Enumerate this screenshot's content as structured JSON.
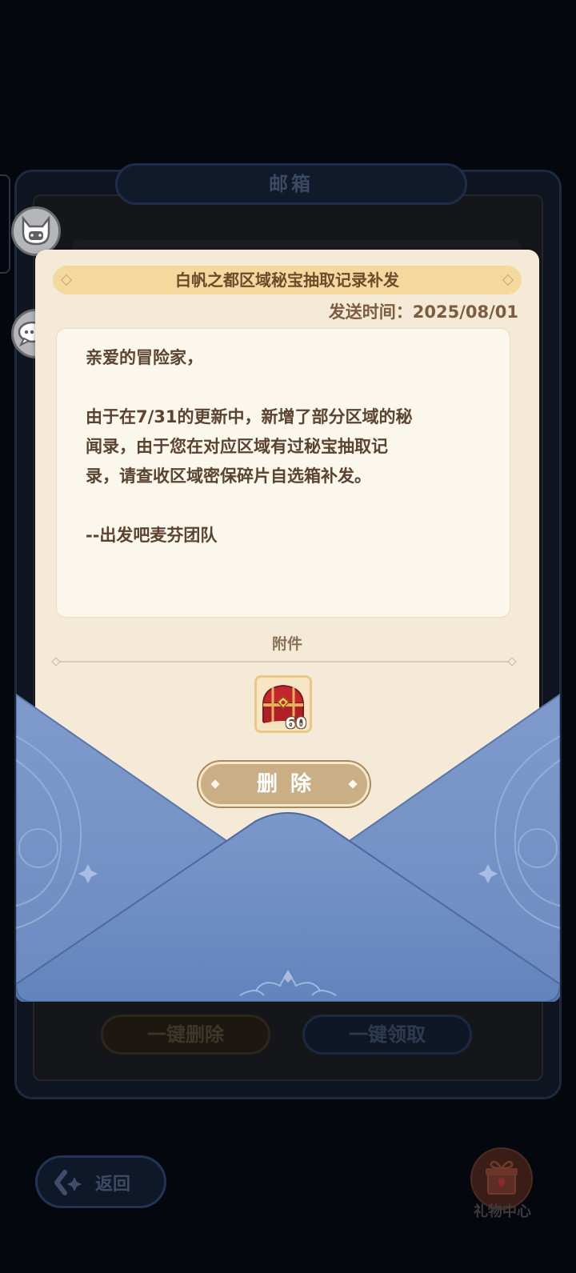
{
  "background": {
    "mailbox_title": "邮箱",
    "batch_delete_label": "一键删除",
    "batch_claim_label": "一键领取"
  },
  "side_icons": [
    {
      "icon": "cat-avatar-icon"
    },
    {
      "icon": "chat-bubbles-icon"
    }
  ],
  "mail": {
    "title": "白帆之都区域秘宝抽取记录补发",
    "send_time": "发送时间：2025/08/01",
    "body": [
      "亲爱的冒险家，",
      "",
      "由于在7/31的更新中，新增了部分区域的秘",
      "闻录，由于您在对应区域有过秘宝抽取记",
      "录，请查收区域密保碎片自选箱补发。",
      "",
      "--出发吧麦芬团队"
    ],
    "attachment_label": "附件",
    "attachments": [
      {
        "icon": "red-treasure-chest-icon",
        "count": "60"
      }
    ],
    "delete_label": "删除"
  },
  "footer": {
    "back_label": "返回",
    "gift_center_label": "礼物中心"
  },
  "colors": {
    "envelope_blue": "#7d9acc",
    "paper": "#f4ead7",
    "title_banner": "#f3d99d",
    "text_brown": "#5b4330",
    "button_tan": "#c9ae86"
  }
}
